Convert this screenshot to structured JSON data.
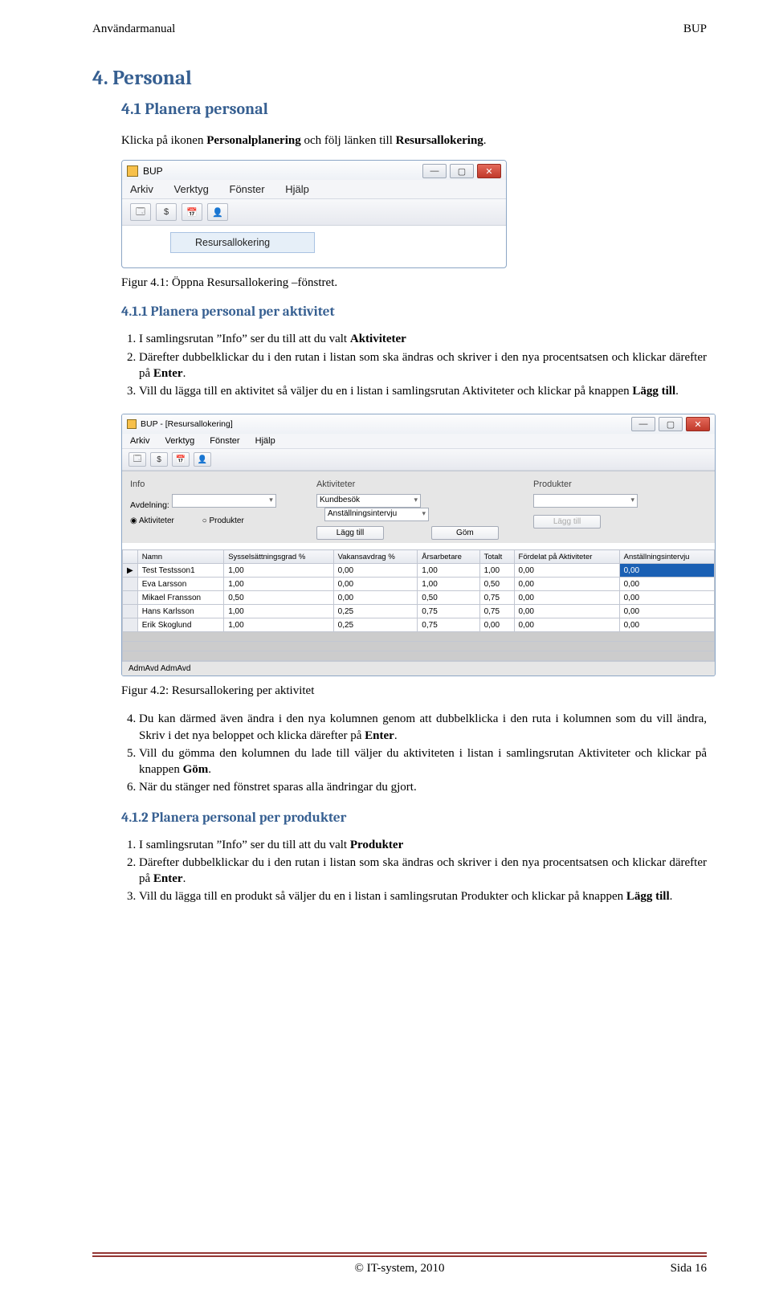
{
  "header": {
    "left": "Användarmanual",
    "right": "BUP"
  },
  "h1": "4. Personal",
  "h2": "4.1    Planera personal",
  "intro_pre": "Klicka på ikonen ",
  "intro_bold": "Personalplanering",
  "intro_mid": " och följ länken till ",
  "intro_bold2": "Resursallokering",
  "intro_post": ".",
  "caption1": "Figur 4.1: Öppna Resursallokering –fönstret.",
  "h3a": "4.1.1 Planera personal per aktivitet",
  "listA": {
    "i1_pre": "I samlingsrutan ”Info” ser du till att du valt ",
    "i1_bold": "Aktiviteter",
    "i2_pre": "Därefter dubbelklickar du i den rutan i listan som ska ändras och skriver i den nya procentsatsen och klickar därefter på ",
    "i2_bold": "Enter",
    "i2_post": ".",
    "i3_pre": "Vill du lägga till en aktivitet så väljer du en i listan i samlingsrutan Aktiviteter och klickar på knappen ",
    "i3_bold": "Lägg till",
    "i3_post": "."
  },
  "caption2": "Figur 4.2: Resursallokering per aktivitet",
  "listB": {
    "i4_pre": "Du kan därmed även ändra i den nya kolumnen genom att dubbelklicka i den ruta i kolumnen som du vill ändra, Skriv i det nya beloppet och klicka därefter på ",
    "i4_bold": "Enter",
    "i4_post": ".",
    "i5_pre": "Vill du gömma den kolumnen du lade till väljer du aktiviteten i listan i samlingsrutan Aktiviteter och klickar på knappen ",
    "i5_bold": "Göm",
    "i5_post": ".",
    "i6": "När du stänger ned fönstret sparas alla ändringar du gjort."
  },
  "h3b": "4.1.2 Planera personal per produkter",
  "listC": {
    "i1_pre": "I samlingsrutan ”Info” ser du till att du valt ",
    "i1_bold": "Produkter",
    "i2_pre": "Därefter dubbelklickar du i den rutan i listan som ska ändras och skriver i den nya procentsatsen och klickar därefter på ",
    "i2_bold": "Enter",
    "i2_post": ".",
    "i3_pre": "Vill du lägga till en produkt så väljer du en i listan i samlingsrutan Produkter och klickar på knappen ",
    "i3_bold": "Lägg till",
    "i3_post": "."
  },
  "footer": {
    "left": "",
    "center": "© IT-system, 2010",
    "right": "Sida 16"
  },
  "ss1": {
    "title": "BUP",
    "menu": [
      "Arkiv",
      "Verktyg",
      "Fönster",
      "Hjälp"
    ],
    "toolbar_icons": [
      "🗔",
      "$",
      "📅",
      "👤"
    ],
    "submenu": "Resursallokering"
  },
  "ss2": {
    "title": "BUP - [Resursallokering]",
    "menu": [
      "Arkiv",
      "Verktyg",
      "Fönster",
      "Hjälp"
    ],
    "toolbar_icons": [
      "🗔",
      "$",
      "📅",
      "👤"
    ],
    "panelInfo": {
      "label": "Info",
      "field_label": "Avdelning:",
      "radio1": "Aktiviteter",
      "radio2": "Produkter"
    },
    "panelAkt": {
      "label": "Aktiviteter",
      "combo1": "Kundbesök",
      "combo2": "Anställningsintervju",
      "btn_add": "Lägg till",
      "btn_hide": "Göm"
    },
    "panelProd": {
      "label": "Produkter",
      "btn_add": "Lägg till"
    },
    "table": {
      "headers": [
        "",
        "Namn",
        "Sysselsättningsgrad %",
        "Vakansavdrag %",
        "Årsarbetare",
        "Totalt",
        "Fördelat på Aktiviteter",
        "Anställningsintervju"
      ],
      "rows": [
        [
          "▶",
          "Test Testsson1",
          "1,00",
          "0,00",
          "1,00",
          "1,00",
          "0,00",
          "0,00"
        ],
        [
          "",
          "Eva Larsson",
          "1,00",
          "0,00",
          "1,00",
          "0,50",
          "0,00",
          "0,00"
        ],
        [
          "",
          "Mikael Fransson",
          "0,50",
          "0,00",
          "0,50",
          "0,75",
          "0,00",
          "0,00"
        ],
        [
          "",
          "Hans Karlsson",
          "1,00",
          "0,25",
          "0,75",
          "0,75",
          "0,00",
          "0,00"
        ],
        [
          "",
          "Erik Skoglund",
          "1,00",
          "0,25",
          "0,75",
          "0,00",
          "0,00",
          "0,00"
        ]
      ]
    },
    "footer": "AdmAvd AdmAvd"
  }
}
